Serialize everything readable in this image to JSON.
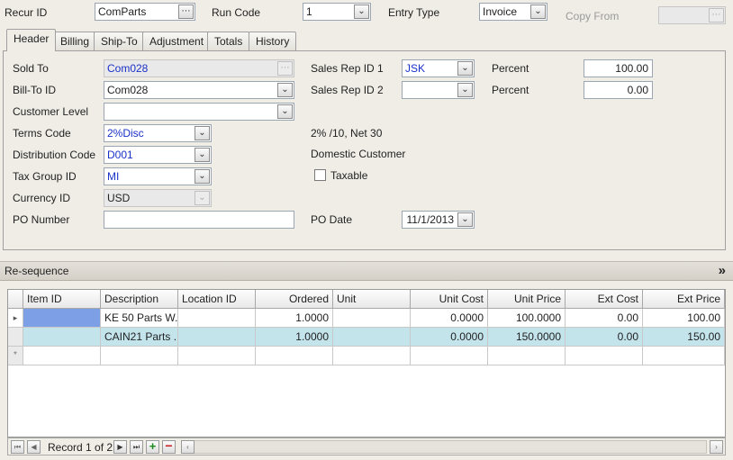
{
  "top": {
    "recur_id_label": "Recur ID",
    "recur_id_value": "ComParts",
    "run_code_label": "Run Code",
    "run_code_value": "1",
    "entry_type_label": "Entry Type",
    "entry_type_value": "Invoice",
    "copy_from_label": "Copy From",
    "copy_from_value": ""
  },
  "tabs": [
    "Header",
    "Billing",
    "Ship-To",
    "Adjustment",
    "Totals",
    "History"
  ],
  "header": {
    "sold_to_label": "Sold To",
    "sold_to_value": "Com028",
    "bill_to_label": "Bill-To ID",
    "bill_to_value": "Com028",
    "customer_level_label": "Customer Level",
    "customer_level_value": "",
    "terms_code_label": "Terms Code",
    "terms_code_value": "2%Disc",
    "terms_desc": "2% /10, Net 30",
    "distribution_code_label": "Distribution Code",
    "distribution_code_value": "D001",
    "distribution_desc": "Domestic Customer",
    "tax_group_label": "Tax Group ID",
    "tax_group_value": "MI",
    "taxable_label": "Taxable",
    "currency_label": "Currency ID",
    "currency_value": "USD",
    "po_number_label": "PO Number",
    "po_number_value": "",
    "po_date_label": "PO Date",
    "po_date_value": "11/1/2013",
    "sales_rep1_label": "Sales Rep ID 1",
    "sales_rep1_value": "JSK",
    "sales_rep2_label": "Sales Rep ID 2",
    "sales_rep2_value": "",
    "percent1_label": "Percent",
    "percent1_value": "100.00",
    "percent2_label": "Percent",
    "percent2_value": "0.00"
  },
  "resequence": {
    "label": "Re-sequence",
    "collapse_glyph": "»"
  },
  "grid": {
    "columns": [
      "Item ID",
      "Description",
      "Location ID",
      "Ordered",
      "Unit",
      "Unit Cost",
      "Unit Price",
      "Ext Cost",
      "Ext Price"
    ],
    "rows": [
      [
        "",
        "KE 50 Parts W...",
        "",
        "1.0000",
        "",
        "0.0000",
        "100.0000",
        "0.00",
        "100.00"
      ],
      [
        "",
        "CAIN21 Parts ...",
        "",
        "1.0000",
        "",
        "0.0000",
        "150.0000",
        "0.00",
        "150.00"
      ]
    ],
    "new_row_marker": "*",
    "current_row_marker": "▸"
  },
  "status": {
    "record_text": "Record 1 of 2"
  }
}
